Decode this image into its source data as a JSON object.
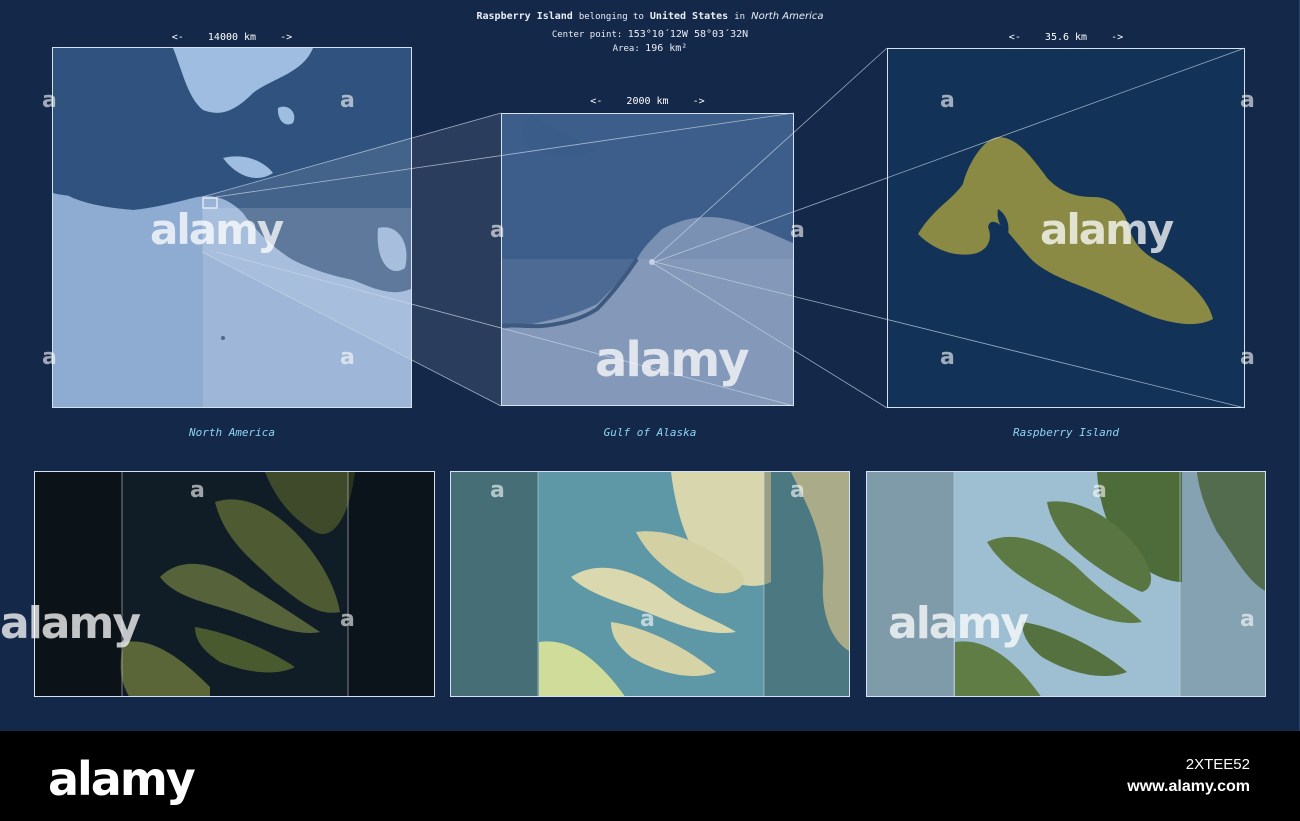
{
  "header": {
    "name": "Raspberry Island",
    "belonging_to": "belonging to",
    "country": "United States",
    "in_word": "in",
    "continent": "North America",
    "center_label": "Center point:",
    "center_value": "153°10´12W  58°03´32N",
    "area_label": "Area:",
    "area_value": "196 km²"
  },
  "scales": {
    "north_america": "<-    14000 km    ->",
    "gulf": "<-    2000 km    ->",
    "island": "<-    35.6 km    ->"
  },
  "captions": {
    "north_america": "North America",
    "gulf": "Gulf of Alaska",
    "island": "Raspberry Island"
  },
  "watermark": {
    "word": "alamy",
    "letter": "a"
  },
  "footer": {
    "logo": "alamy",
    "image_id": "2XTEE52",
    "site": "www.alamy.com"
  },
  "colors": {
    "background": "#14284a",
    "island_fill": "#8a8a45",
    "caption": "#8fd4f2"
  }
}
